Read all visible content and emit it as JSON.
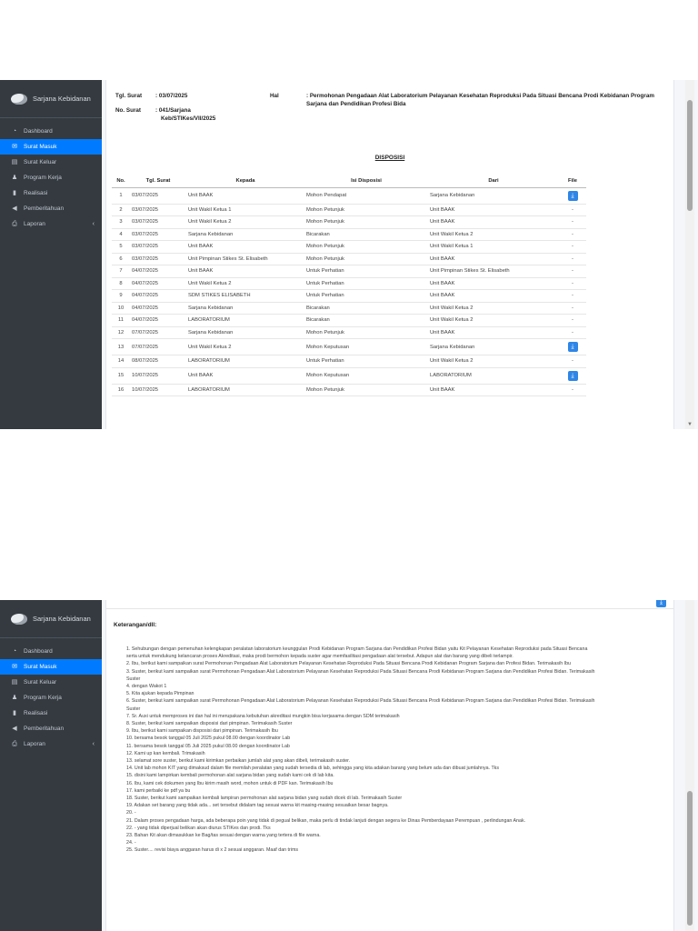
{
  "sidebar": {
    "brand": "Sarjana Kebidanan",
    "items": [
      {
        "label": "Dashboard",
        "icon": "dashboard-icon",
        "active": false
      },
      {
        "label": "Surat Masuk",
        "icon": "mail-icon",
        "active": true
      },
      {
        "label": "Surat Keluar",
        "icon": "inbox-icon",
        "active": false
      },
      {
        "label": "Program Kerja",
        "icon": "users-icon",
        "active": false
      },
      {
        "label": "Realisasi",
        "icon": "file-icon",
        "active": false
      },
      {
        "label": "Pemberitahuan",
        "icon": "megaphone-icon",
        "active": false
      },
      {
        "label": "Laporan",
        "icon": "print-icon",
        "active": false
      }
    ]
  },
  "letter": {
    "tgl_label": "Tgl. Surat",
    "tgl_value": ": 03/07/2025",
    "no_label": "No. Surat",
    "no_value_1": ": 041/Sarjana",
    "no_value_2": "Keb/STIKes/VII/2025",
    "hal_label": "Hal",
    "hal_value": ": Permohonan Pengadaan Alat Laboratorium Pelayanan Kesehatan Reproduksi Pada Situasi Bencana Prodi Kebidanan Program Sarjana dan Pendidikan Profesi Bida"
  },
  "disposisi": {
    "title": "DISPOSISI",
    "headers": [
      "No.",
      "Tgl. Surat",
      "Kepada",
      "Isi Disposisi",
      "Dari",
      "File"
    ],
    "rows": [
      {
        "no": "1",
        "tgl": "03/07/2025",
        "kepada": "Unit BAAK",
        "isi": "Mohon Pendapat",
        "dari": "Sarjana Kebidanan",
        "file": true
      },
      {
        "no": "2",
        "tgl": "03/07/2025",
        "kepada": "Unit Wakil Ketua 1",
        "isi": "Mohon Petunjuk",
        "dari": "Unit BAAK",
        "file": false
      },
      {
        "no": "3",
        "tgl": "03/07/2025",
        "kepada": "Unit Wakil Ketua 2",
        "isi": "Mohon Petunjuk",
        "dari": "Unit BAAK",
        "file": false
      },
      {
        "no": "4",
        "tgl": "03/07/2025",
        "kepada": "Sarjana Kebidanan",
        "isi": "Bicarakan",
        "dari": "Unit Wakil Ketua 2",
        "file": false
      },
      {
        "no": "5",
        "tgl": "03/07/2025",
        "kepada": "Unit BAAK",
        "isi": "Mohon Petunjuk",
        "dari": "Unit Wakil Ketua 1",
        "file": false
      },
      {
        "no": "6",
        "tgl": "03/07/2025",
        "kepada": "Unit Pimpinan Stikes St. Elisabeth",
        "isi": "Mohon Petunjuk",
        "dari": "Unit BAAK",
        "file": false
      },
      {
        "no": "7",
        "tgl": "04/07/2025",
        "kepada": "Unit BAAK",
        "isi": "Untuk Perhatian",
        "dari": "Unit Pimpinan Stikes St. Elisabeth",
        "file": false
      },
      {
        "no": "8",
        "tgl": "04/07/2025",
        "kepada": "Unit Wakil Ketua 2",
        "isi": "Untuk Perhatian",
        "dari": "Unit BAAK",
        "file": false
      },
      {
        "no": "9",
        "tgl": "04/07/2025",
        "kepada": "SDM STIKES ELISABETH",
        "isi": "Untuk Perhatian",
        "dari": "Unit BAAK",
        "file": false
      },
      {
        "no": "10",
        "tgl": "04/07/2025",
        "kepada": "Sarjana Kebidanan",
        "isi": "Bicarakan",
        "dari": "Unit Wakil Ketua 2",
        "file": false
      },
      {
        "no": "11",
        "tgl": "04/07/2025",
        "kepada": "LABORATORIUM",
        "isi": "Bicarakan",
        "dari": "Unit Wakil Ketua 2",
        "file": false
      },
      {
        "no": "12",
        "tgl": "07/07/2025",
        "kepada": "Sarjana Kebidanan",
        "isi": "Mohon Petunjuk",
        "dari": "Unit BAAK",
        "file": false
      },
      {
        "no": "13",
        "tgl": "07/07/2025",
        "kepada": "Unit Wakil Ketua 2",
        "isi": "Mohon Keputusan",
        "dari": "Sarjana Kebidanan",
        "file": true
      },
      {
        "no": "14",
        "tgl": "08/07/2025",
        "kepada": "LABORATORIUM",
        "isi": "Untuk Perhatian",
        "dari": "Unit Wakil Ketua 2",
        "file": false
      },
      {
        "no": "15",
        "tgl": "10/07/2025",
        "kepada": "Unit BAAK",
        "isi": "Mohon Keputusan",
        "dari": "LABORATORIUM",
        "file": true
      },
      {
        "no": "16",
        "tgl": "10/07/2025",
        "kepada": "LABORATORIUM",
        "isi": "Mohon Petunjuk",
        "dari": "Unit BAAK",
        "file": false
      }
    ],
    "no_file": "-"
  },
  "keterangan": {
    "title": "Keterangan/dll:",
    "notes": [
      "1. Sehubungan dengan pemenuhan kelengkapan peralatan laboratorium keunggulan Prodi Kebidanan Program Sarjana dan Pendidikan Profesi Bidan yaitu Kit Pelayanan Kesehatan Reproduksi pada Situasi Bencana",
      "serta untuk mendukung kelancaran proses Akreditasi, maka prodi bermohon kepada suster agar memfasilitasi pengadaan alat tersebut. Adapun alat dan barang yang dibeli terlampir.",
      "2. Ibu, berikut kami sampaikan surat Permohonan Pengadaan Alat Laboratorium Pelayanan Kesehatan Reproduksi Pada Situasi Bencana Prodi Kebidanan Program Sarjana dan Profesi Bidan. Terimakasih Ibu",
      "3. Suster, berikut kami sampaikan surat Permohonan Pengadaan Alat Laboratorium Pelayanan Kesehatan Reproduksi Pada Situasi Bencana Prodi Kebidanan Program Sarjana dan Pendidikan Profesi Bidan. Terimakasih",
      "Suster",
      "4. dengan Wakot 1",
      "5. Kita ajukan kepada Pimpinan",
      "6. Suster, berikut kami sampaikan surat Permohonan Pengadaan Alat Laboratorium Pelayanan Kesehatan Reproduksi Pada Situasi Bencana Prodi Kebidanan Program Sarjana dan Pendidikan Profesi Bidan. Terimakasih",
      "Suster",
      "7. Sr. Auxi untuk memproses ini dan hal ini merupakana kebutuhan akreditasi mungkin bisa kerjasama dengan SDM terimakasih",
      "8. Suster, berikut kami sampaikan disposisi dari pimpinan. Terimakasih Suster",
      "9. Ibu, berikut kami sampaikan disposisi dari pimpinan. Terimakasih Ibu",
      "10. bersama besok tanggal 05 Juli 2025 pukul 08.00 dengan koordinator Lab",
      "11. bersama besok tanggal 05 Juli 2025 pukul 08.00 dengan koordinator Lab",
      "12. Kami up kan kembali. Trimakasih",
      "13. selamat sore suster, berikut kami kirimkan perbaikan jumlah alat yang akan dibeli, terimakasih suster.",
      "14. Unit lab mohon KIT yang dimaksud dalam file memilah peralatan yang sudah tersedia di lab, sehingga yang kita adakan barang yang belum ada dan dibuat jumlahnya. Tks",
      "15. disini kami lampirkan kembali permohonan alat sarjana bidan yang sudah kami cek di lab kita.",
      "16. Ibu, kami cek dokumen yang Ibu kirim masih word, mohon untuk di PDF kan. Terimakasih Ibu",
      "17. kami perbaiki ke pdf ya bu",
      "18. Suster, berikut kami sampaikan kembali lampiran permohonan alat sarjana bidan yang sudah dicek di lab. Terimakasih Suster",
      "19. Adakan set barang yang tidak ada... set tersebut didalam tag sesuai warna kit masing-masing sesuaikan besar bagnya.",
      "20. -",
      "21. Dalam proses pengadaan harga, ada beberapa poin yang tidak di pegual belikan, maka perlu di tindak lanjuti dengan segera ke Dinas Pemberdayaan Perempuan , perlindungan Anak.",
      "22. - yang tidak diperjual belikan akan diurus STIKes dan prodi. Tks",
      "23. Bahan Kit akan dimasukkan ke Bag/tas sesuai dengan warna yang tertera di file warna.",
      "24. -",
      "25. Suster.... revisi biaya anggaran harus di x 2 sesuai anggaran. Maaf dan trims"
    ]
  },
  "colors": {
    "sidebar_bg": "#343a40",
    "active_item": "#007bff",
    "file_button": "#2e86e6"
  }
}
